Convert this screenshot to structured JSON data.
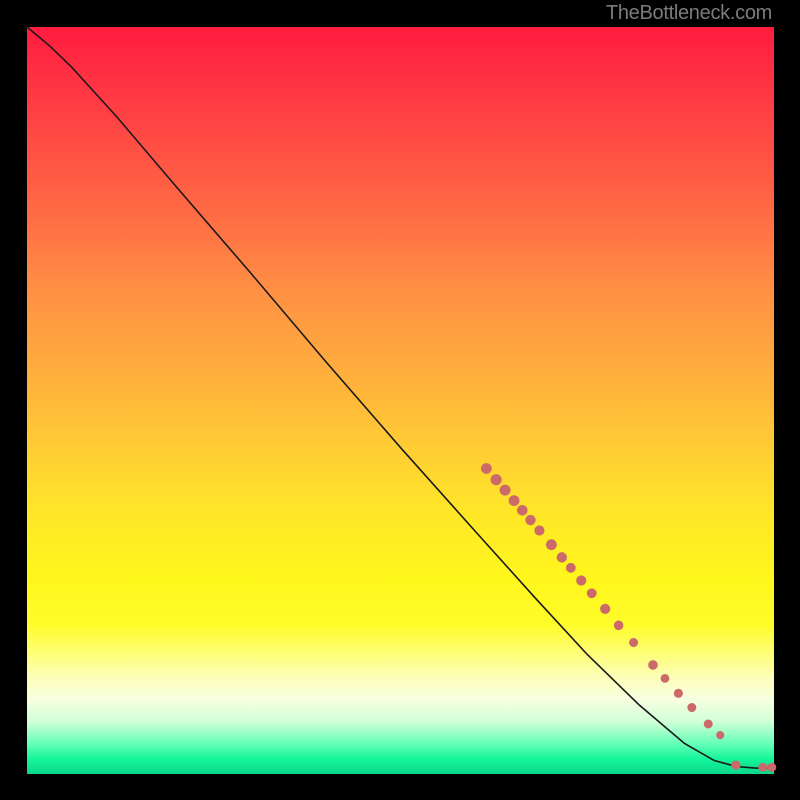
{
  "watermark": "TheBottleneck.com",
  "colors": {
    "dot": "#cc6a6a",
    "line": "#1a1a1a"
  },
  "chart_data": {
    "type": "line",
    "title": "",
    "xlabel": "",
    "ylabel": "",
    "xlim": [
      0,
      100
    ],
    "ylim": [
      0,
      100
    ],
    "grid": false,
    "curve": [
      {
        "x": 0.0,
        "y": 100.0
      },
      {
        "x": 3.0,
        "y": 97.5
      },
      {
        "x": 6.0,
        "y": 94.6
      },
      {
        "x": 9.0,
        "y": 91.3
      },
      {
        "x": 12.0,
        "y": 88.0
      },
      {
        "x": 20.0,
        "y": 78.6
      },
      {
        "x": 30.0,
        "y": 67.0
      },
      {
        "x": 40.0,
        "y": 55.2
      },
      {
        "x": 50.0,
        "y": 43.7
      },
      {
        "x": 60.0,
        "y": 32.5
      },
      {
        "x": 68.0,
        "y": 23.6
      },
      {
        "x": 75.0,
        "y": 16.0
      },
      {
        "x": 82.0,
        "y": 9.2
      },
      {
        "x": 88.0,
        "y": 4.1
      },
      {
        "x": 92.0,
        "y": 1.8
      },
      {
        "x": 95.0,
        "y": 1.0
      },
      {
        "x": 97.5,
        "y": 0.8
      },
      {
        "x": 100.0,
        "y": 0.8
      }
    ],
    "dots": [
      {
        "x": 61.5,
        "y": 40.9,
        "r": 4.9
      },
      {
        "x": 62.8,
        "y": 39.4,
        "r": 5.1
      },
      {
        "x": 64.0,
        "y": 38.0,
        "r": 5.0
      },
      {
        "x": 65.2,
        "y": 36.6,
        "r": 4.9
      },
      {
        "x": 66.3,
        "y": 35.3,
        "r": 4.8
      },
      {
        "x": 67.4,
        "y": 34.0,
        "r": 4.7
      },
      {
        "x": 68.6,
        "y": 32.6,
        "r": 4.6
      },
      {
        "x": 70.2,
        "y": 30.7,
        "r": 4.9
      },
      {
        "x": 71.6,
        "y": 29.0,
        "r": 4.7
      },
      {
        "x": 72.8,
        "y": 27.6,
        "r": 4.4
      },
      {
        "x": 74.2,
        "y": 25.9,
        "r": 4.6
      },
      {
        "x": 75.6,
        "y": 24.2,
        "r": 4.4
      },
      {
        "x": 77.4,
        "y": 22.1,
        "r": 4.6
      },
      {
        "x": 79.2,
        "y": 19.9,
        "r": 4.3
      },
      {
        "x": 81.2,
        "y": 17.6,
        "r": 4.0
      },
      {
        "x": 83.8,
        "y": 14.6,
        "r": 4.3
      },
      {
        "x": 85.4,
        "y": 12.8,
        "r": 3.9
      },
      {
        "x": 87.2,
        "y": 10.8,
        "r": 4.1
      },
      {
        "x": 89.0,
        "y": 8.9,
        "r": 4.0
      },
      {
        "x": 91.2,
        "y": 6.7,
        "r": 4.0
      },
      {
        "x": 92.8,
        "y": 5.2,
        "r": 3.6
      },
      {
        "x": 94.9,
        "y": 1.2,
        "r": 4.1
      },
      {
        "x": 98.5,
        "y": 0.9,
        "r": 4.0
      },
      {
        "x": 99.7,
        "y": 0.9,
        "r": 4.0
      }
    ]
  }
}
